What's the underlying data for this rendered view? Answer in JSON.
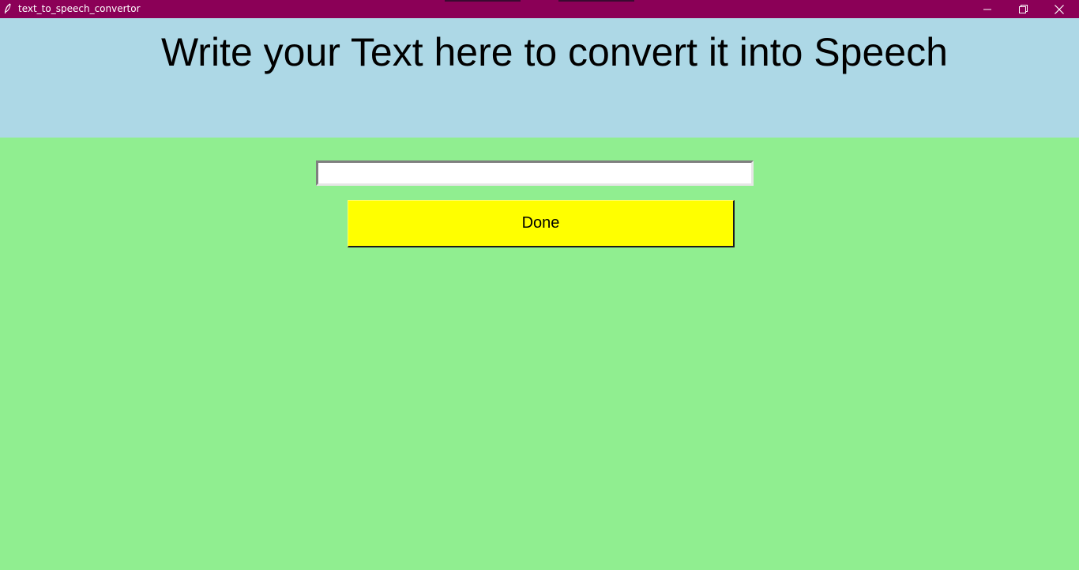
{
  "window": {
    "title": "text_to_speech_convertor",
    "icon": "feather-icon",
    "controls": {
      "minimize_icon": "minimize-icon",
      "maximize_icon": "restore-icon",
      "close_icon": "close-icon"
    },
    "titlebar_color": "#8b0057"
  },
  "header": {
    "text": "Write your Text here to convert it into Speech",
    "background": "#add8e6"
  },
  "form": {
    "input_value": "",
    "button_label": "Done",
    "button_color": "#ffff00",
    "background": "#90ee90"
  }
}
